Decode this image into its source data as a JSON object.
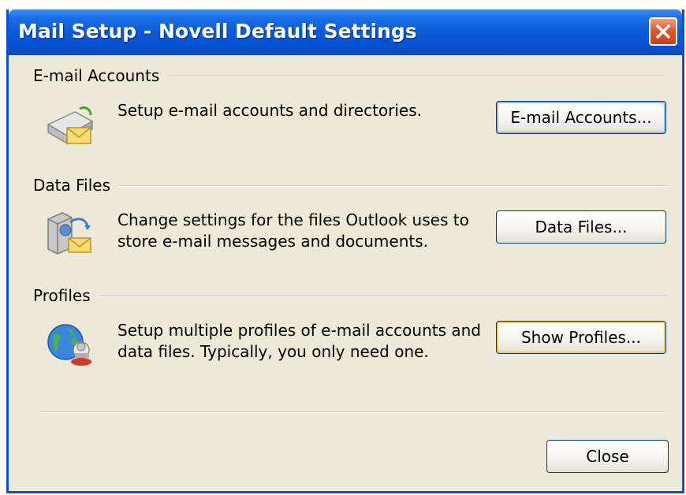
{
  "window": {
    "title": "Mail Setup - Novell Default Settings",
    "close_icon": "close-x-icon"
  },
  "sections": {
    "email_accounts": {
      "heading": "E-mail Accounts",
      "description": "Setup e-mail accounts and directories.",
      "button_label": "E-mail Accounts...",
      "icon": "email-accounts-icon"
    },
    "data_files": {
      "heading": "Data Files",
      "description_line1": "Change settings for the files Outlook uses to",
      "description_line2": "store e-mail messages and documents.",
      "button_label": "Data Files...",
      "icon": "data-files-icon"
    },
    "profiles": {
      "heading": "Profiles",
      "description_line1": "Setup multiple profiles of e-mail accounts and",
      "description_line2": "data files. Typically, you only need one.",
      "button_label": "Show Profiles...",
      "icon": "profiles-icon"
    }
  },
  "footer": {
    "close_label": "Close"
  },
  "colors": {
    "titlebar": "#0a5ad8",
    "dialog_bg": "#ece9d8",
    "button_border": "#003c74",
    "close_button": "#e25a2a"
  }
}
